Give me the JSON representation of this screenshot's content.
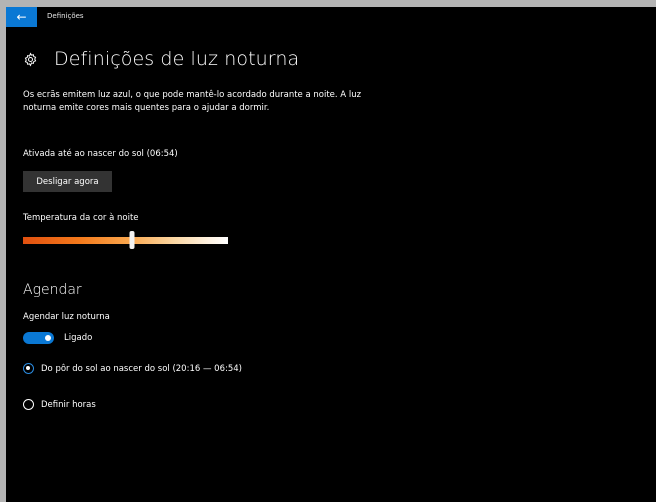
{
  "window": {
    "title": "Definições",
    "back_icon": "arrow-left-icon",
    "back_glyph": "←"
  },
  "header": {
    "icon": "gear-icon",
    "title": "Definições de luz noturna"
  },
  "description": "Os ecrãs emitem luz azul, o que pode mantê-lo acordado durante a noite. A luz noturna emite cores mais quentes para o ajudar a dormir.",
  "status_text": "Ativada até ao nascer do sol (06:54)",
  "turn_off_button": "Desligar agora",
  "color_temperature": {
    "label": "Temperatura da cor à noite",
    "value_fraction": 0.53,
    "colors": [
      "#e1500f",
      "#f47a1c",
      "#f9a74e",
      "#fbd7a4",
      "#ffffff"
    ]
  },
  "schedule": {
    "section_title": "Agendar",
    "toggle_label": "Agendar luz noturna",
    "toggle_state_text": "Ligado",
    "toggle_on": true,
    "options": [
      {
        "label": "Do pôr do sol ao nascer do sol (20:16 — 06:54)",
        "selected": true
      },
      {
        "label": "Definir horas",
        "selected": false
      }
    ]
  },
  "accent_color": "#0a78d4"
}
